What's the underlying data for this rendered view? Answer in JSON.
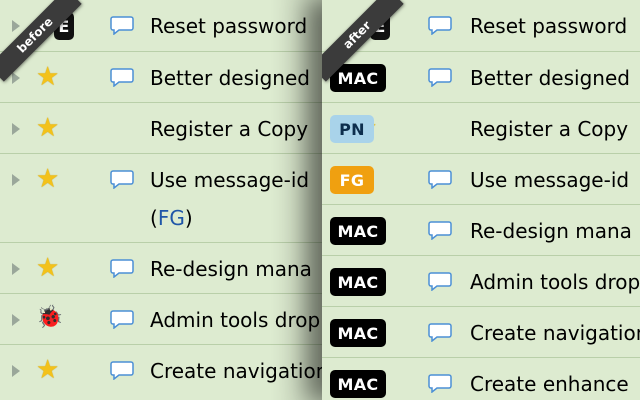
{
  "before": {
    "ribbon": "before",
    "rows": [
      {
        "title": "Reset password",
        "tag": "E"
      },
      {
        "title": "Better designed"
      },
      {
        "title": "Register a Copy"
      },
      {
        "title": "Use message-id",
        "sub_open": "(",
        "sub_link": "FG",
        "sub_close": ")"
      },
      {
        "title": "Re-design mana"
      },
      {
        "title": "Admin tools drop"
      },
      {
        "title": "Create navigation"
      }
    ]
  },
  "after": {
    "ribbon": "after",
    "rows": [
      {
        "title": "Reset password",
        "badge": "E"
      },
      {
        "title": "Better designed",
        "badge": "MAC"
      },
      {
        "title": "Register a Copy",
        "badge": "PN"
      },
      {
        "title": "Use message-id",
        "badge": "FG"
      },
      {
        "title": "Re-design mana",
        "badge": "MAC"
      },
      {
        "title": "Admin tools drop",
        "badge": "MAC"
      },
      {
        "title": "Create navigation",
        "badge": "MAC"
      },
      {
        "title": "Create enhance",
        "badge": "MAC"
      }
    ]
  },
  "colors": {
    "row_bg": "#ddebd0",
    "row_border": "#b9cfa9",
    "star": "#f3c21b",
    "priority_bars": "#3466c9",
    "mac_badge": "#000000",
    "pn_badge": "#a9d3ea",
    "fg_badge": "#f0a010"
  }
}
